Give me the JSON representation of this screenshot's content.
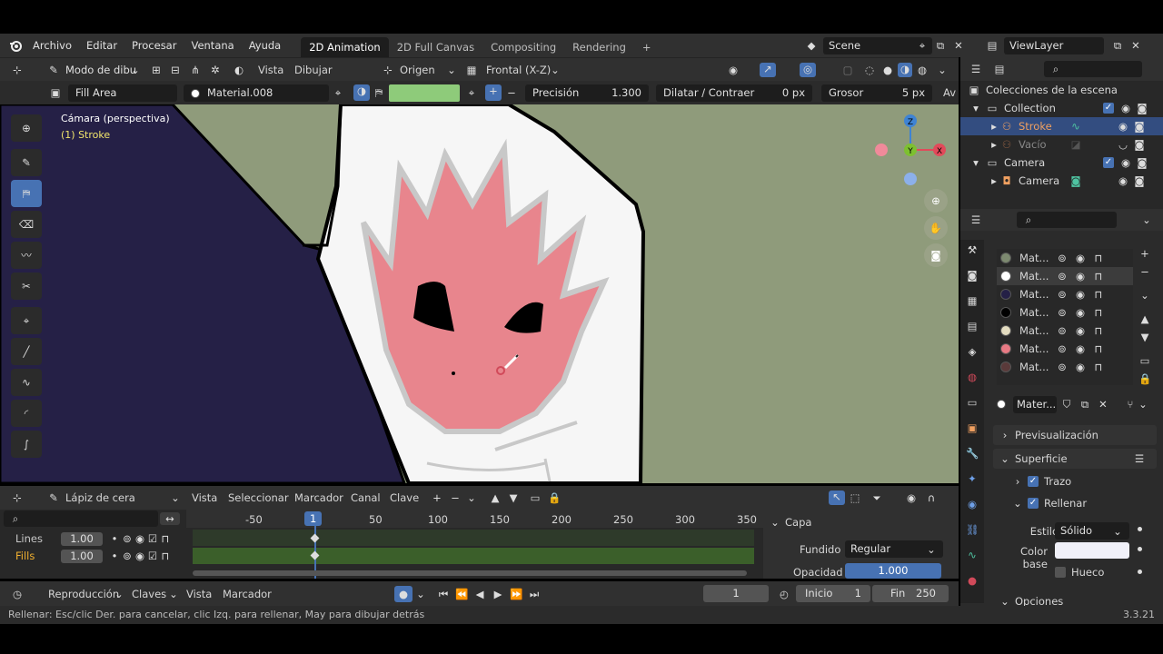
{
  "menu": {
    "items": [
      "Archivo",
      "Editar",
      "Procesar",
      "Ventana",
      "Ayuda"
    ],
    "workspaces": [
      "2D Animation",
      "2D Full Canvas",
      "Compositing",
      "Rendering"
    ],
    "add_tab": "+",
    "scene_label": "Scene",
    "viewlayer_label": "ViewLayer"
  },
  "toolbar": {
    "mode": "Modo de dibu",
    "vista": "Vista",
    "dibujar": "Dibujar",
    "origen": "Origen",
    "view": "Frontal (X-Z)"
  },
  "toolsettings": {
    "brush": "Fill Area",
    "material": "Material.008",
    "fill_color": "#8ecb7a",
    "precision_label": "Precisión",
    "precision_value": "1.300",
    "dilate_label": "Dilatar / Contraer",
    "dilate_value": "0 px",
    "thickness_label": "Grosor",
    "thickness_value": "5 px",
    "truncated": "Av"
  },
  "viewport": {
    "camera_label": "Cámara (perspectiva)",
    "object_label": "(1) Stroke",
    "gizmo": {
      "z": "Z",
      "y": "Y",
      "x": "X"
    }
  },
  "outliner": {
    "root": "Colecciones de la escena",
    "rows": [
      {
        "label": "Collection"
      },
      {
        "label": "Stroke"
      },
      {
        "label": "Vacío"
      },
      {
        "label": "Camera"
      },
      {
        "label": "Camera"
      }
    ]
  },
  "materials": {
    "items": [
      {
        "label": "Mat...",
        "color": "#7d8a70"
      },
      {
        "label": "Mat...",
        "color": "#ffffff"
      },
      {
        "label": "Mat...",
        "color": "#242046"
      },
      {
        "label": "Mat...",
        "color": "#000000"
      },
      {
        "label": "Mat...",
        "color": "#e3dcc0"
      },
      {
        "label": "Mat...",
        "color": "#e87a84"
      },
      {
        "label": "Mat...",
        "color": "#5a3a3a"
      }
    ],
    "active_name": "Mater...",
    "preview": "Previsualización",
    "surface": "Superficie",
    "trazo": "Trazo",
    "rellenar": "Rellenar",
    "estilo_label": "Estilo",
    "estilo_value": "Sólido",
    "color_base_label": "Color base",
    "hueco_label": "Hueco",
    "opciones": "Opciones"
  },
  "timeline": {
    "brush": "Lápiz de cera",
    "menus": [
      "Vista",
      "Seleccionar",
      "Marcador",
      "Canal",
      "Clave"
    ],
    "frame_ticks": [
      "-50",
      "1",
      "50",
      "100",
      "150",
      "200",
      "250",
      "300",
      "350"
    ],
    "channels": [
      {
        "label": "Lines",
        "value": "1.00"
      },
      {
        "label": "Fills",
        "value": "1.00"
      }
    ]
  },
  "capa": {
    "title": "Capa",
    "blend_label": "Fundido",
    "blend_value": "Regular",
    "opacity_label": "Opacidad",
    "opacity_value": "1.000"
  },
  "playback": {
    "reproduccion": "Reproducción",
    "claves": "Claves",
    "vista": "Vista",
    "marcador": "Marcador",
    "current_frame": "1",
    "start_label": "Inicio",
    "start_value": "1",
    "end_label": "Fin",
    "end_value": "250"
  },
  "status": {
    "hint": "Rellenar: Esc/clic Der. para cancelar, clic Izq. para rellenar, May para dibujar detrás",
    "version": "3.3.21"
  }
}
